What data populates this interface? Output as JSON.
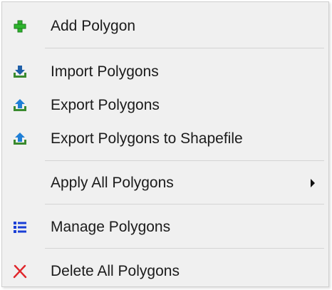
{
  "menu": {
    "items": [
      {
        "label": "Add Polygon",
        "icon": "plus-icon",
        "color": "#2db52d"
      },
      {
        "label": "Import Polygons",
        "icon": "import-tray-icon",
        "color": "#3a8a2e"
      },
      {
        "label": "Export Polygons",
        "icon": "export-tray-icon",
        "color": "#1f7fd6"
      },
      {
        "label": "Export Polygons to Shapefile",
        "icon": "export-tray-icon",
        "color": "#1f7fd6"
      },
      {
        "label": "Apply All Polygons",
        "icon": "",
        "submenu": true
      },
      {
        "label": "Manage Polygons",
        "icon": "list-icon",
        "color": "#1a3fd6"
      },
      {
        "label": "Delete All Polygons",
        "icon": "x-icon",
        "color": "#e0262b"
      }
    ]
  }
}
